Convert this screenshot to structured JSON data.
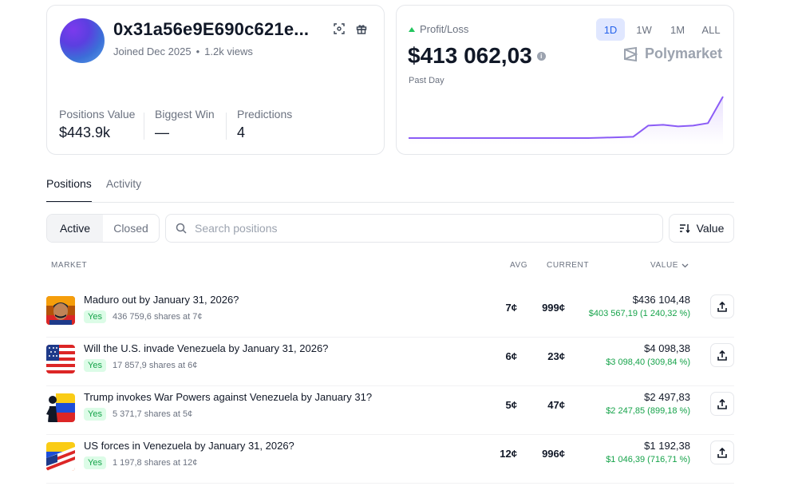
{
  "profile": {
    "address": "0x31a56e9E690c621e...",
    "joined": "Joined Dec 2025",
    "views": "1.2k views",
    "stats": [
      {
        "label": "Positions Value",
        "value": "$443.9k"
      },
      {
        "label": "Biggest Win",
        "value": "—"
      },
      {
        "label": "Predictions",
        "value": "4"
      }
    ],
    "icons": [
      "scan-icon",
      "gift-icon"
    ]
  },
  "pnl": {
    "label": "Profit/Loss",
    "value": "$413 062,03",
    "period": "Past Day",
    "ranges": [
      "1D",
      "1W",
      "1M",
      "ALL"
    ],
    "active_range": "1D",
    "brand": "Polymarket",
    "colors": {
      "up": "#22c55e",
      "line": "#8b5cf6",
      "active_tab": "#2563eb"
    },
    "chart_data": {
      "type": "line",
      "values": [
        0.0,
        0.0,
        0.0,
        0.0,
        0.0,
        0.0,
        0.0,
        0.0,
        0.0,
        0.0,
        0.0,
        0.0,
        0.0,
        0.01,
        0.02,
        0.03,
        0.3,
        0.32,
        0.28,
        0.3,
        0.36,
        1.0
      ],
      "title": "",
      "xlabel": "",
      "ylabel": ""
    }
  },
  "tabs": [
    {
      "label": "Positions",
      "active": true
    },
    {
      "label": "Activity",
      "active": false
    }
  ],
  "filters": {
    "active": "Active",
    "closed": "Closed"
  },
  "search": {
    "placeholder": "Search positions",
    "value": ""
  },
  "sort": {
    "label": "Value"
  },
  "table": {
    "headers": {
      "market": "MARKET",
      "avg": "AVG",
      "current": "CURRENT",
      "value": "VALUE"
    },
    "rows": [
      {
        "title": "Maduro out by January 31, 2026?",
        "outcome": "Yes",
        "shares": "436 759,6 shares at 7¢",
        "avg": "7¢",
        "current": "999¢",
        "value": "$436 104,48",
        "gain": "$403 567,19 (1 240,32 %)",
        "thumb": "portrait"
      },
      {
        "title": "Will the U.S. invade Venezuela by January 31, 2026?",
        "outcome": "Yes",
        "shares": "17 857,9 shares at 6¢",
        "avg": "6¢",
        "current": "23¢",
        "value": "$4 098,38",
        "gain": "$3 098,40 (309,84 %)",
        "thumb": "us-flag"
      },
      {
        "title": "Trump invokes War Powers against Venezuela by January 31?",
        "outcome": "Yes",
        "shares": "5 371,7 shares at 5¢",
        "avg": "5¢",
        "current": "47¢",
        "value": "$2 497,83",
        "gain": "$2 247,85 (899,18 %)",
        "thumb": "vz-flag-figure"
      },
      {
        "title": "US forces in Venezuela by January 31, 2026?",
        "outcome": "Yes",
        "shares": "1 197,8 shares at 12¢",
        "avg": "12¢",
        "current": "996¢",
        "value": "$1 192,38",
        "gain": "$1 046,39 (716,71 %)",
        "thumb": "us-vz-flags"
      }
    ]
  }
}
